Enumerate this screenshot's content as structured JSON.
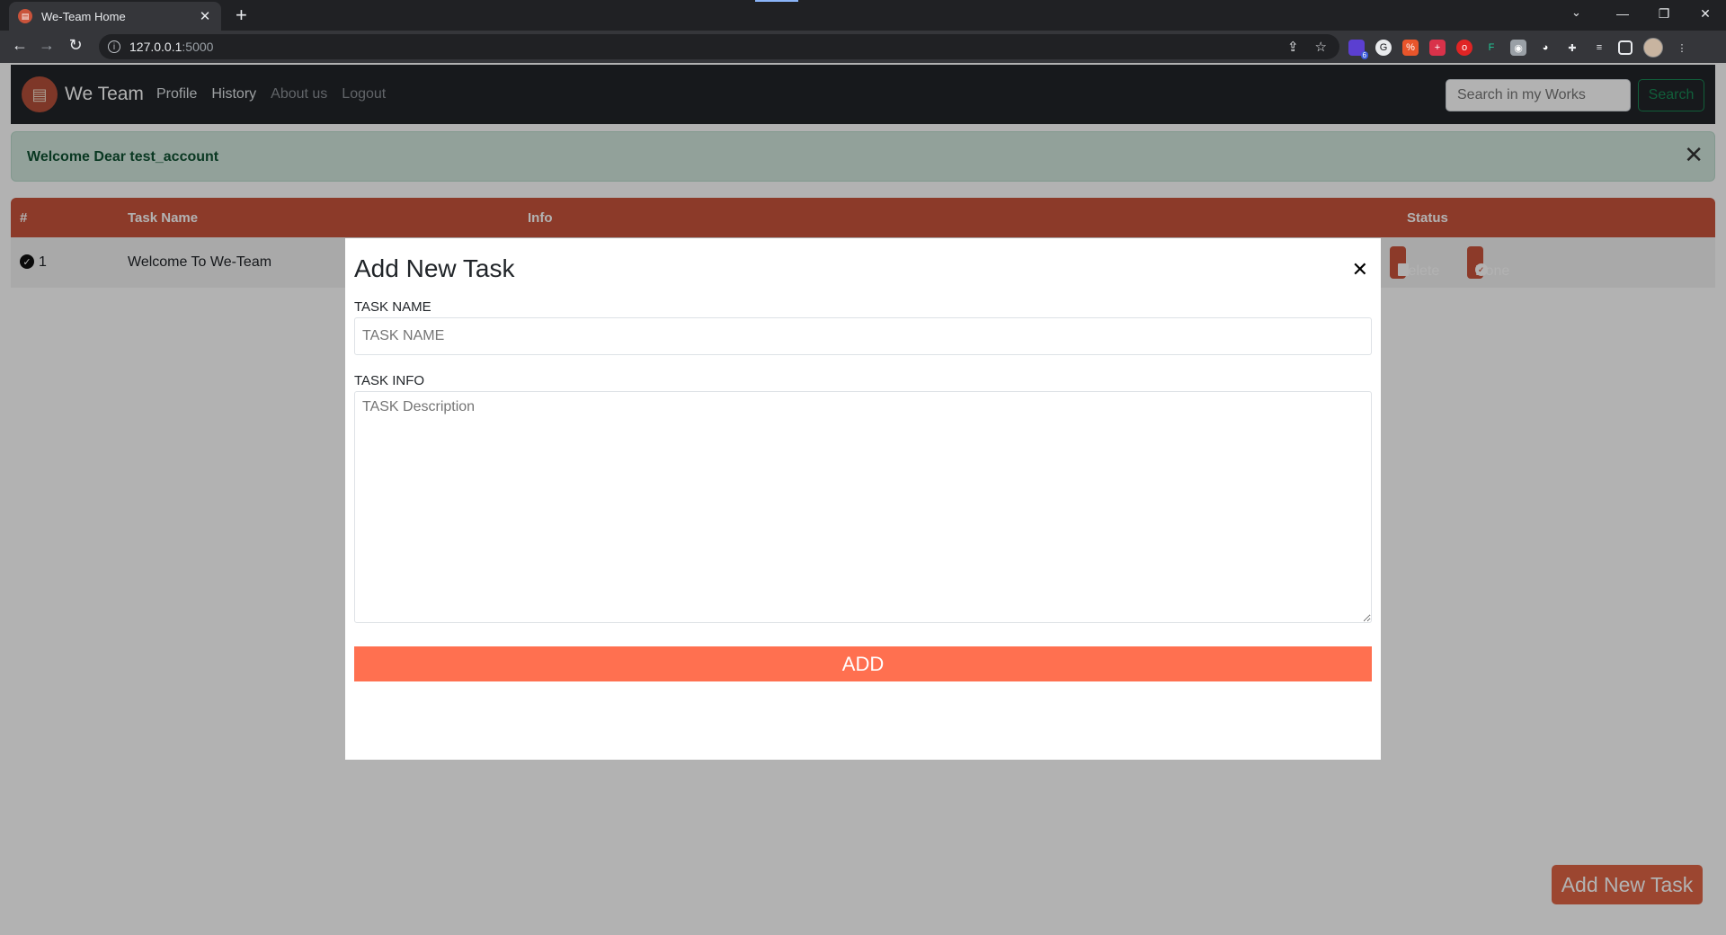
{
  "browser": {
    "tab_title": "We-Team Home",
    "favicon_glyph": "▤",
    "url_host": "127.0.0.1",
    "url_port": ":5000",
    "newtab_label": "+",
    "close_glyph": "✕",
    "ext_badge": "6"
  },
  "navbar": {
    "brand": "We Team",
    "links": [
      "Profile",
      "History",
      "About us",
      "Logout"
    ],
    "search_placeholder": "Search in my Works",
    "search_button": "Search"
  },
  "alert": {
    "message": "Welcome Dear test_account",
    "close_glyph": "✕"
  },
  "table": {
    "headers": [
      "#",
      "Task Name",
      "Info",
      "Status"
    ],
    "rows": [
      {
        "index": "1",
        "task_name": "Welcome To We-Team",
        "info": "",
        "status": "done"
      }
    ],
    "delete_label": "Delete",
    "done_label": "Done"
  },
  "fab": {
    "label": "Add New Task"
  },
  "modal": {
    "title": "Add New Task",
    "close_glyph": "✕",
    "task_name_label": "TASK NAME",
    "task_name_placeholder": "TASK NAME",
    "task_info_label": "TASK INFO",
    "task_info_placeholder": "TASK Description",
    "submit_label": "ADD"
  },
  "colors": {
    "accent": "#c9533b",
    "submit": "#ff7050",
    "alert_bg": "#d1e7dd",
    "alert_text": "#0f5132",
    "navbar_bg": "#212529",
    "search_green": "#198754"
  }
}
